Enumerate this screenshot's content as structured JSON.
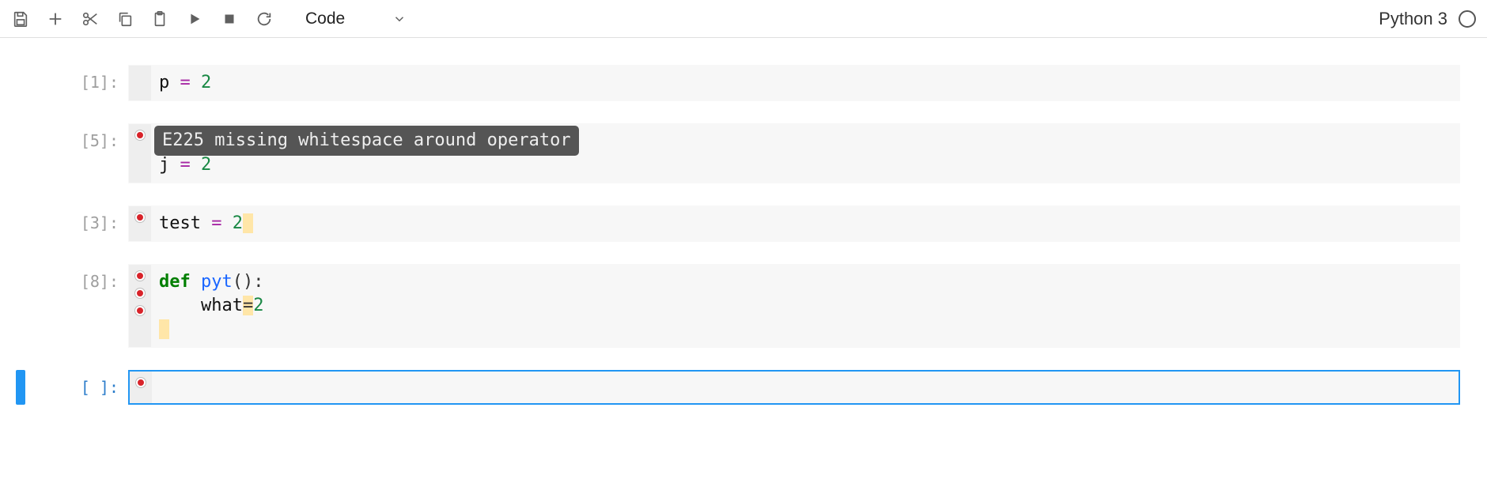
{
  "toolbar": {
    "cell_type": "Code"
  },
  "kernel": {
    "name": "Python 3"
  },
  "cells": [
    {
      "exec_count": "1",
      "lint": false,
      "lines": [
        {
          "tokens": [
            {
              "t": "var",
              "v": "p"
            },
            {
              "t": "txt",
              "v": " "
            },
            {
              "t": "op",
              "v": "="
            },
            {
              "t": "txt",
              "v": " "
            },
            {
              "t": "num",
              "v": "2"
            }
          ]
        }
      ]
    },
    {
      "exec_count": "5",
      "lint": true,
      "tooltip": "E225 missing whitespace around operator",
      "lines": [
        {
          "tokens": []
        },
        {
          "tokens": [
            {
              "t": "var",
              "v": "j"
            },
            {
              "t": "txt",
              "v": " "
            },
            {
              "t": "op",
              "v": "="
            },
            {
              "t": "txt",
              "v": " "
            },
            {
              "t": "num",
              "v": "2"
            }
          ]
        }
      ]
    },
    {
      "exec_count": "3",
      "lint": true,
      "lines": [
        {
          "tokens": [
            {
              "t": "var",
              "v": "test"
            },
            {
              "t": "txt",
              "v": " "
            },
            {
              "t": "op",
              "v": "="
            },
            {
              "t": "txt",
              "v": " "
            },
            {
              "t": "num",
              "v": "2"
            },
            {
              "t": "hl",
              "v": " "
            }
          ]
        }
      ]
    },
    {
      "exec_count": "8",
      "lint": true,
      "lint_rows": 3,
      "lines": [
        {
          "tokens": [
            {
              "t": "kw",
              "v": "def"
            },
            {
              "t": "txt",
              "v": " "
            },
            {
              "t": "fn",
              "v": "pyt"
            },
            {
              "t": "txt",
              "v": "():"
            }
          ]
        },
        {
          "tokens": [
            {
              "t": "txt",
              "v": "    "
            },
            {
              "t": "var",
              "v": "what"
            },
            {
              "t": "hl",
              "v": "="
            },
            {
              "t": "num",
              "v": "2"
            }
          ]
        },
        {
          "tokens": [
            {
              "t": "hl",
              "v": " "
            }
          ]
        }
      ]
    },
    {
      "exec_count": " ",
      "lint": true,
      "active": true,
      "lines": [
        {
          "tokens": []
        }
      ]
    }
  ]
}
